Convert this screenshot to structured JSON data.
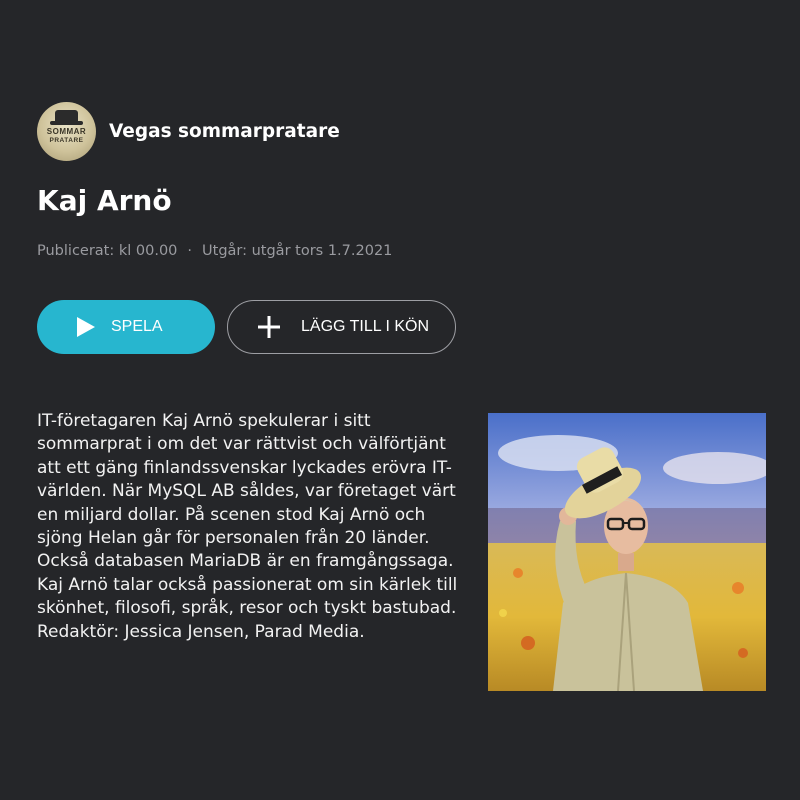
{
  "program": {
    "name": "Vegas sommarpratare",
    "logo_text_line1": "SOMMAR",
    "logo_text_line2": "PRATARE"
  },
  "episode": {
    "title": "Kaj Arnö",
    "published": "Publicerat: kl 00.00",
    "separator": "·",
    "expires": "Utgår: utgår tors 1.7.2021"
  },
  "actions": {
    "play_label": "SPELA",
    "queue_label": "LÄGG TILL I KÖN",
    "play_icon": "play-icon",
    "queue_icon": "plus-icon"
  },
  "description": {
    "text": "IT-företagaren Kaj Arnö spekulerar i sitt sommarprat i om det var rättvist och välförtjänt att ett gäng finlandssvenskar lyckades erövra IT-världen. När MySQL AB såldes, var företaget värt en miljard dollar. På scenen stod Kaj Arnö och sjöng Helan går för personalen från 20 länder. Också databasen MariaDB är en framgångssaga. Kaj Arnö talar också passionerat om sin kärlek till skönhet, filosofi, språk, resor och tyskt bastubad.",
    "editor": "Redaktör: Jessica Jensen, Parad Media."
  },
  "colors": {
    "background": "#252629",
    "accent": "#27b6cf",
    "muted_text": "#9a9ba0"
  }
}
